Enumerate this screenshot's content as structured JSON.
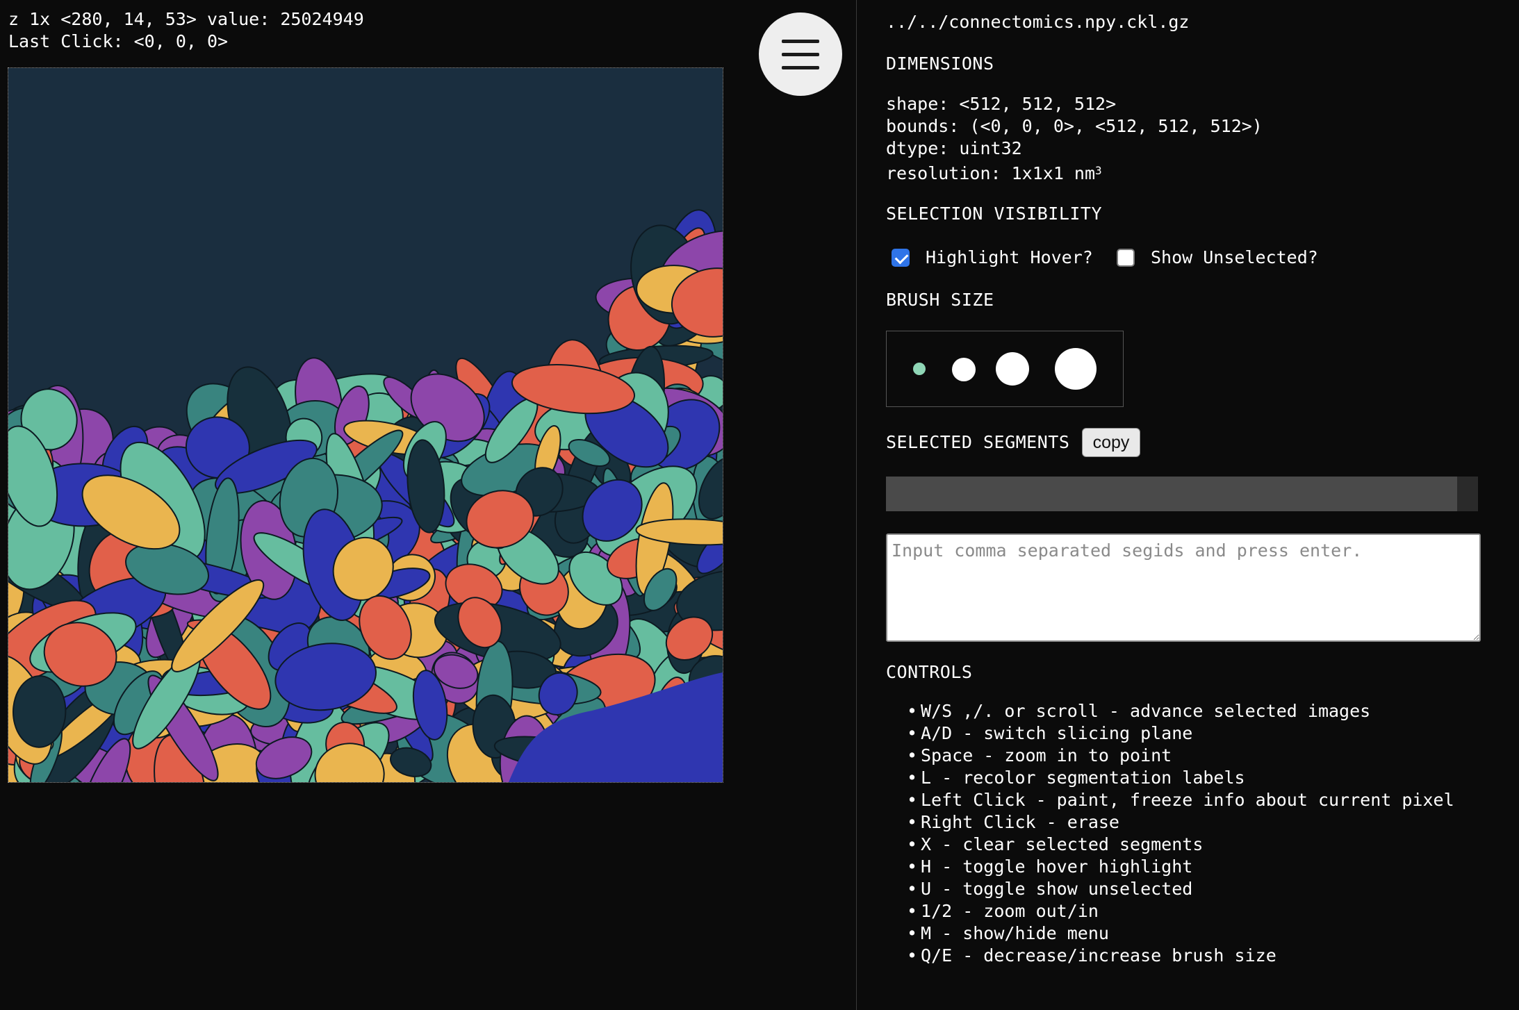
{
  "viewer": {
    "cursor_info": "z 1x <280, 14, 53> value: 25024949",
    "click_info": "Last Click: <0, 0, 0>",
    "palette": [
      "#1a2e3f",
      "#e1604a",
      "#2f36b0",
      "#66bd9f",
      "#39847f",
      "#8d46aa",
      "#eab54f",
      "#17303c"
    ],
    "menu_icon": "hamburger-menu-icon"
  },
  "panel": {
    "file_path": "../../connectomics.npy.ckl.gz",
    "dimensions": {
      "heading": "DIMENSIONS",
      "shape": "shape: <512, 512, 512>",
      "bounds": "bounds: (<0, 0, 0>, <512, 512, 512>)",
      "dtype": "dtype: uint32",
      "resolution": "resolution: 1x1x1 nm",
      "resolution_exp": "3"
    },
    "selection_visibility": {
      "heading": "SELECTION VISIBILITY",
      "highlight_hover_label": "Highlight Hover?",
      "highlight_hover_checked": true,
      "show_unselected_label": "Show Unselected?",
      "show_unselected_checked": false
    },
    "brush_size": {
      "heading": "BRUSH SIZE",
      "selected_index": 0,
      "selected_color": "#8fd6b6",
      "sizes": [
        "small",
        "medium",
        "large",
        "x-large"
      ]
    },
    "selected_segments": {
      "heading": "SELECTED SEGMENTS",
      "copy_label": "copy",
      "input_placeholder": "Input comma separated segids and press enter.",
      "input_value": ""
    },
    "controls": {
      "heading": "CONTROLS",
      "items": [
        "W/S ,/. or scroll - advance selected images",
        "A/D - switch slicing plane",
        "Space - zoom in to point",
        "L - recolor segmentation labels",
        "Left Click - paint, freeze info about current pixel",
        "Right Click - erase",
        "X - clear selected segments",
        "H - toggle hover highlight",
        "U - toggle show unselected",
        "1/2 - zoom out/in",
        "M - show/hide menu",
        "Q/E - decrease/increase brush size"
      ]
    }
  }
}
